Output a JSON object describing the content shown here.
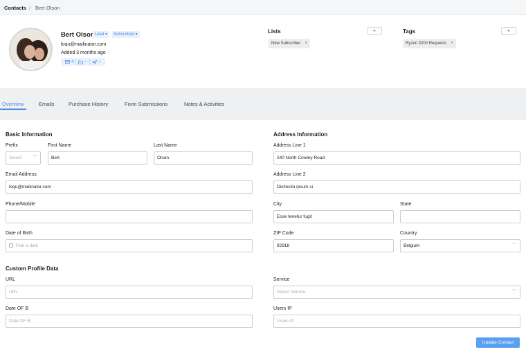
{
  "breadcrumb": {
    "root": "Contacts",
    "separator": "/",
    "current": "Bert Olson"
  },
  "contact": {
    "name": "Bert Olson",
    "type_badge": "Lead",
    "status_badge": "Subscribed",
    "email": "loqu@mailinator.com",
    "added": "Added 3 months ago",
    "stats": {
      "emails": "4",
      "folders": "--",
      "sent": "--"
    }
  },
  "lists": {
    "title": "Lists",
    "add_label": "+",
    "items": [
      "New Subscriber"
    ]
  },
  "tags": {
    "title": "Tags",
    "add_label": "+",
    "items": [
      "Ryzen 3200 Requests"
    ]
  },
  "tabs": [
    "Overview",
    "Emails",
    "Purchase History",
    "Form Submissions",
    "Notes & Activities"
  ],
  "basic": {
    "title": "Basic Information",
    "prefix_label": "Prefix",
    "prefix_placeholder": "Select",
    "first_name_label": "First Name",
    "first_name": "Bert",
    "last_name_label": "Last Name",
    "last_name": "Olson",
    "email_label": "Email Address",
    "email": "loqu@mailinator.com",
    "phone_label": "Phone/Mobile",
    "phone": "",
    "dob_label": "Date of Birth",
    "dob_placeholder": "Pick a date"
  },
  "address": {
    "title": "Address Information",
    "line1_label": "Address Line 1",
    "line1": "240 North Cowley Road",
    "line2_label": "Address Line 2",
    "line2": "Distinctio ipsum si",
    "city_label": "City",
    "city": "Esse tenetur fugit",
    "state_label": "State",
    "state": "",
    "zip_label": "ZIP Code",
    "zip": "92918",
    "country_label": "Country",
    "country": "Belgium"
  },
  "custom": {
    "title": "Custom Profile Data",
    "url_label": "URL",
    "url_placeholder": "URL",
    "date_of_b_label": "Date OF B",
    "date_of_b_placeholder": "Date OF B",
    "service_label": "Service",
    "service_placeholder": "Select Service",
    "users_ip_label": "Users IP",
    "users_ip_placeholder": "Users IP"
  },
  "update_button": "Update Contact",
  "colors": {
    "accent": "#4a8be6",
    "button": "#5aa0f0"
  }
}
